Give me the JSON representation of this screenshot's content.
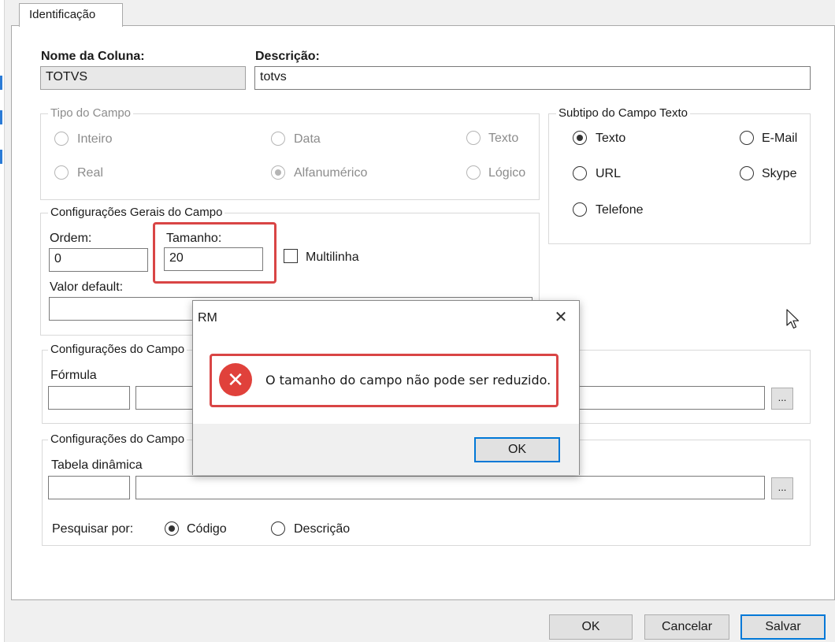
{
  "tab": {
    "label": "Identificação"
  },
  "nome": {
    "label": "Nome da Coluna:",
    "value": "TOTVS"
  },
  "descricao": {
    "label": "Descrição:",
    "value": "totvs"
  },
  "tipo_campo": {
    "title": "Tipo do Campo",
    "options": [
      "Inteiro",
      "Data",
      "Texto",
      "Real",
      "Alfanumérico",
      "Lógico"
    ],
    "selected": "Alfanumérico"
  },
  "subtipo": {
    "title": "Subtipo do Campo Texto",
    "options": [
      "Texto",
      "E-Mail",
      "URL",
      "Skype",
      "Telefone"
    ],
    "selected": "Texto"
  },
  "config_gerais": {
    "title": "Configurações Gerais do Campo",
    "ordem_label": "Ordem:",
    "ordem_value": "0",
    "tamanho_label": "Tamanho:",
    "tamanho_value": "20",
    "multilinha_label": "Multilinha",
    "valor_default_label": "Valor default:"
  },
  "config_formula": {
    "title": "Configurações do Campo",
    "formula_label": "Fórmula",
    "browse": "..."
  },
  "config_tabela": {
    "title": "Configurações do Campo",
    "tabela_label": "Tabela dinâmica",
    "browse": "...",
    "pesquisar_label": "Pesquisar por:",
    "options": [
      "Código",
      "Descrição"
    ],
    "selected": "Código"
  },
  "buttons": {
    "ok": "OK",
    "cancelar": "Cancelar",
    "salvar": "Salvar"
  },
  "dialog": {
    "title": "RM",
    "message": "O tamanho do campo não pode ser reduzido.",
    "ok": "OK",
    "close_glyph": "✕",
    "error_glyph": "✕"
  },
  "colors": {
    "highlight": "#d94545",
    "focus": "#0078d7",
    "error": "#e0413b"
  }
}
